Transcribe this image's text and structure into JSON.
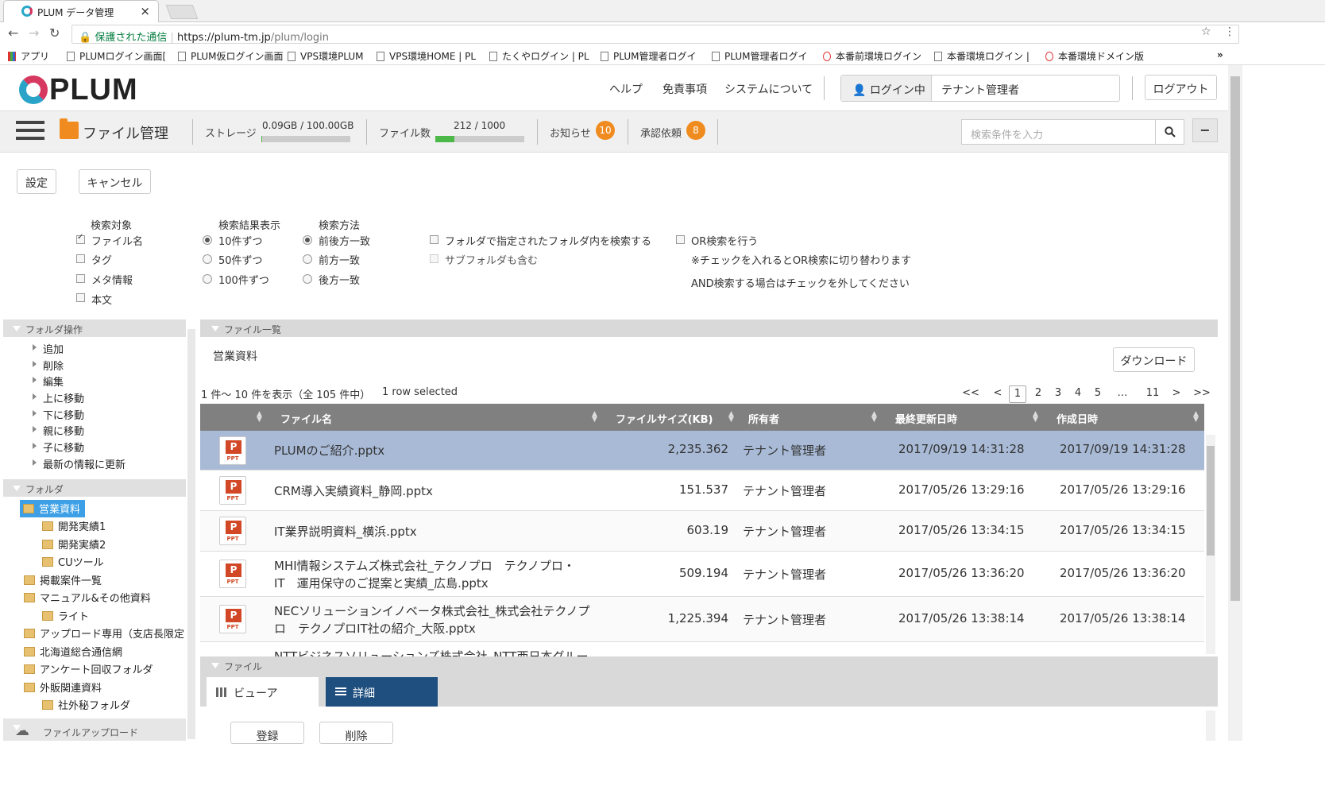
{
  "browser": {
    "tab_title": "PLUM データ管理",
    "tab_close": "×",
    "secure_label": "保護された通信",
    "url_host": "https://plum-tm.jp",
    "url_path": "/plum/login",
    "bookmarks": [
      "アプリ",
      "PLUMログイン画面[",
      "PLUM仮ログイン画面",
      "VPS環境PLUM",
      "VPS環境HOME | PL",
      "たくやログイン | PL",
      "PLUM管理者ログイ",
      "PLUM管理者ログイ",
      "本番前環境ログイン",
      "本番環境ログイン |",
      "本番環境ドメイン版"
    ],
    "bookmarks_more": "»"
  },
  "header": {
    "logo": "PLUM",
    "links": [
      "ヘルプ",
      "免責事項",
      "システムについて"
    ],
    "login_state": "ログイン中",
    "user": "テナント管理者",
    "logout": "ログアウト"
  },
  "toolbar": {
    "title": "ファイル管理",
    "storage_label": "ストレージ",
    "storage_value": "0.09GB / 100.00GB",
    "storage_fraction": 0.0009,
    "files_label": "ファイル数",
    "files_value": "212 / 1000",
    "files_fraction": 0.212,
    "notice_label": "お知らせ",
    "notice_count": "10",
    "approval_label": "承認依頼",
    "approval_count": "8",
    "search_placeholder": "検索条件を入力",
    "collapse": "−"
  },
  "form": {
    "settings": "設定",
    "cancel": "キャンセル",
    "target_title": "検索対象",
    "targets": [
      {
        "label": "ファイル名",
        "checked": true
      },
      {
        "label": "タグ",
        "checked": false
      },
      {
        "label": "メタ情報",
        "checked": false
      },
      {
        "label": "本文",
        "checked": false
      }
    ],
    "display_title": "検索結果表示",
    "displays": [
      {
        "label": "10件ずつ",
        "checked": true
      },
      {
        "label": "50件ずつ",
        "checked": false
      },
      {
        "label": "100件ずつ",
        "checked": false
      }
    ],
    "method_title": "検索方法",
    "methods": [
      {
        "label": "前後方一致",
        "checked": true
      },
      {
        "label": "前方一致",
        "checked": false
      },
      {
        "label": "後方一致",
        "checked": false
      }
    ],
    "folder_search": "フォルダで指定されたフォルダ内を検索する",
    "subfolder": "サブフォルダも含む",
    "or_search": "OR検索を行う",
    "or_note1": "※チェックを入れるとOR検索に切り替わります",
    "or_note2": "AND検索する場合はチェックを外してください"
  },
  "left": {
    "ops_title": "フォルダ操作",
    "ops": [
      "追加",
      "削除",
      "編集",
      "上に移動",
      "下に移動",
      "親に移動",
      "子に移動",
      "最新の情報に更新"
    ],
    "folder_title": "フォルダ",
    "folders": [
      "営業資料",
      "開発実績1",
      "開発実績2",
      "CUツール",
      "掲載案件一覧",
      "マニュアル&その他資料",
      "ライト",
      "アップロード専用（支店長限定",
      "北海道総合通信網",
      "アンケート回収フォルダ",
      "外販関連資料",
      "社外秘フォルダ"
    ],
    "upload": "ファイルアップロード"
  },
  "main": {
    "title": "ファイル一覧",
    "folder_name": "営業資料",
    "download": "ダウンロード",
    "count_text": "1 件～ 10 件を表示（全 105 件中）",
    "selected_text": "1 row selected",
    "pages": [
      "<<",
      "<",
      "1",
      "2",
      "3",
      "4",
      "5",
      "…",
      "11",
      ">",
      ">>"
    ],
    "columns": [
      "ファイル名",
      "ファイルサイズ(KB)",
      "所有者",
      "最終更新日時",
      "作成日時"
    ],
    "icon_label": "PPT",
    "icon_letter": "P",
    "rows": [
      {
        "name1": "PLUMのご紹介.pptx",
        "name2": "",
        "size": "2,235.362",
        "owner": "テナント管理者",
        "updated": "2017/09/19 14:31:28",
        "created": "2017/09/19 14:31:28"
      },
      {
        "name1": "CRM導入実績資料_静岡.pptx",
        "name2": "",
        "size": "151.537",
        "owner": "テナント管理者",
        "updated": "2017/05/26 13:29:16",
        "created": "2017/05/26 13:29:16"
      },
      {
        "name1": "IT業界説明資料_横浜.pptx",
        "name2": "",
        "size": "603.19",
        "owner": "テナント管理者",
        "updated": "2017/05/26 13:34:15",
        "created": "2017/05/26 13:34:15"
      },
      {
        "name1": "MHI情報システムズ株式会社_テクノプロ　テクノプロ・",
        "name2": "IT　運用保守のご提案と実績_広島.pptx",
        "size": "509.194",
        "owner": "テナント管理者",
        "updated": "2017/05/26 13:36:20",
        "created": "2017/05/26 13:36:20"
      },
      {
        "name1": "NECソリューションイノベータ株式会社_株式会社テクノプ",
        "name2": "ロ　テクノプロIT社の紹介_大阪.pptx",
        "size": "1,225.394",
        "owner": "テナント管理者",
        "updated": "2017/05/26 13:38:14",
        "created": "2017/05/26 13:38:14"
      },
      {
        "name1": "NTTビジネスソリューションズ株式会社_NTT西日本グルー",
        "name2": "",
        "size": "",
        "owner": "",
        "updated": "",
        "created": ""
      }
    ]
  },
  "file": {
    "title": "ファイル",
    "tab_viewer": "ビューア",
    "tab_detail": "詳細",
    "register": "登録",
    "delete": "削除"
  },
  "colors": {
    "accent": "#f08c1f",
    "selected_row": "#a8bad6",
    "detail_tab": "#1f4f7f",
    "tree_selected": "#3da0e6",
    "progress": "#4cb848"
  }
}
